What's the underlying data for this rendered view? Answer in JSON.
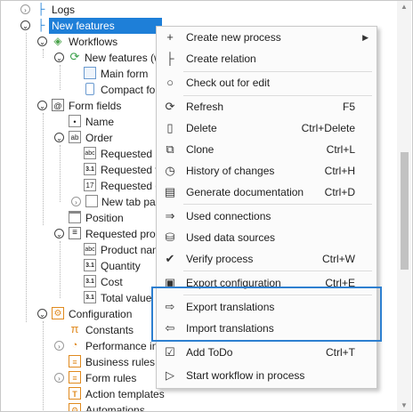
{
  "tree": {
    "logs": "Logs",
    "new_features": "New features",
    "workflows": "Workflows",
    "new_features_workflow": "New features (w",
    "main_form": "Main form",
    "compact_form": "Compact form",
    "form_fields": "Form fields",
    "name": "Name",
    "order": "Order",
    "requested_items": "Requested ite",
    "requested_value": "Requested valu",
    "requested_date": "Requested da",
    "new_tab_panel": "New tab pane",
    "position": "Position",
    "requested_products": "Requested produ",
    "product_name": "Product name",
    "quantity": "Quantity",
    "cost": "Cost",
    "total_value": "Total value",
    "configuration": "Configuration",
    "constants": "Constants",
    "performance": "Performance indi",
    "business_rules": "Business rules",
    "form_rules": "Form rules",
    "action_templates": "Action templates",
    "automations": "Automations"
  },
  "menu": {
    "create_process": "Create new process",
    "create_relation": "Create relation",
    "check_out": "Check out for edit",
    "refresh": "Refresh",
    "refresh_sc": "F5",
    "delete": "Delete",
    "delete_sc": "Ctrl+Delete",
    "clone": "Clone",
    "clone_sc": "Ctrl+L",
    "history": "History of changes",
    "history_sc": "Ctrl+H",
    "gen_doc": "Generate documentation",
    "gen_doc_sc": "Ctrl+D",
    "used_connections": "Used connections",
    "used_data_sources": "Used data sources",
    "verify": "Verify process",
    "verify_sc": "Ctrl+W",
    "export_config": "Export configuration",
    "export_config_sc": "Ctrl+E",
    "export_trans": "Export translations",
    "import_trans": "Import translations",
    "add_todo": "Add ToDo",
    "add_todo_sc": "Ctrl+T",
    "start_workflow": "Start workflow in process"
  },
  "colors": {
    "selection": "#1e7fd8",
    "highlight_border": "#2d7fd0"
  }
}
